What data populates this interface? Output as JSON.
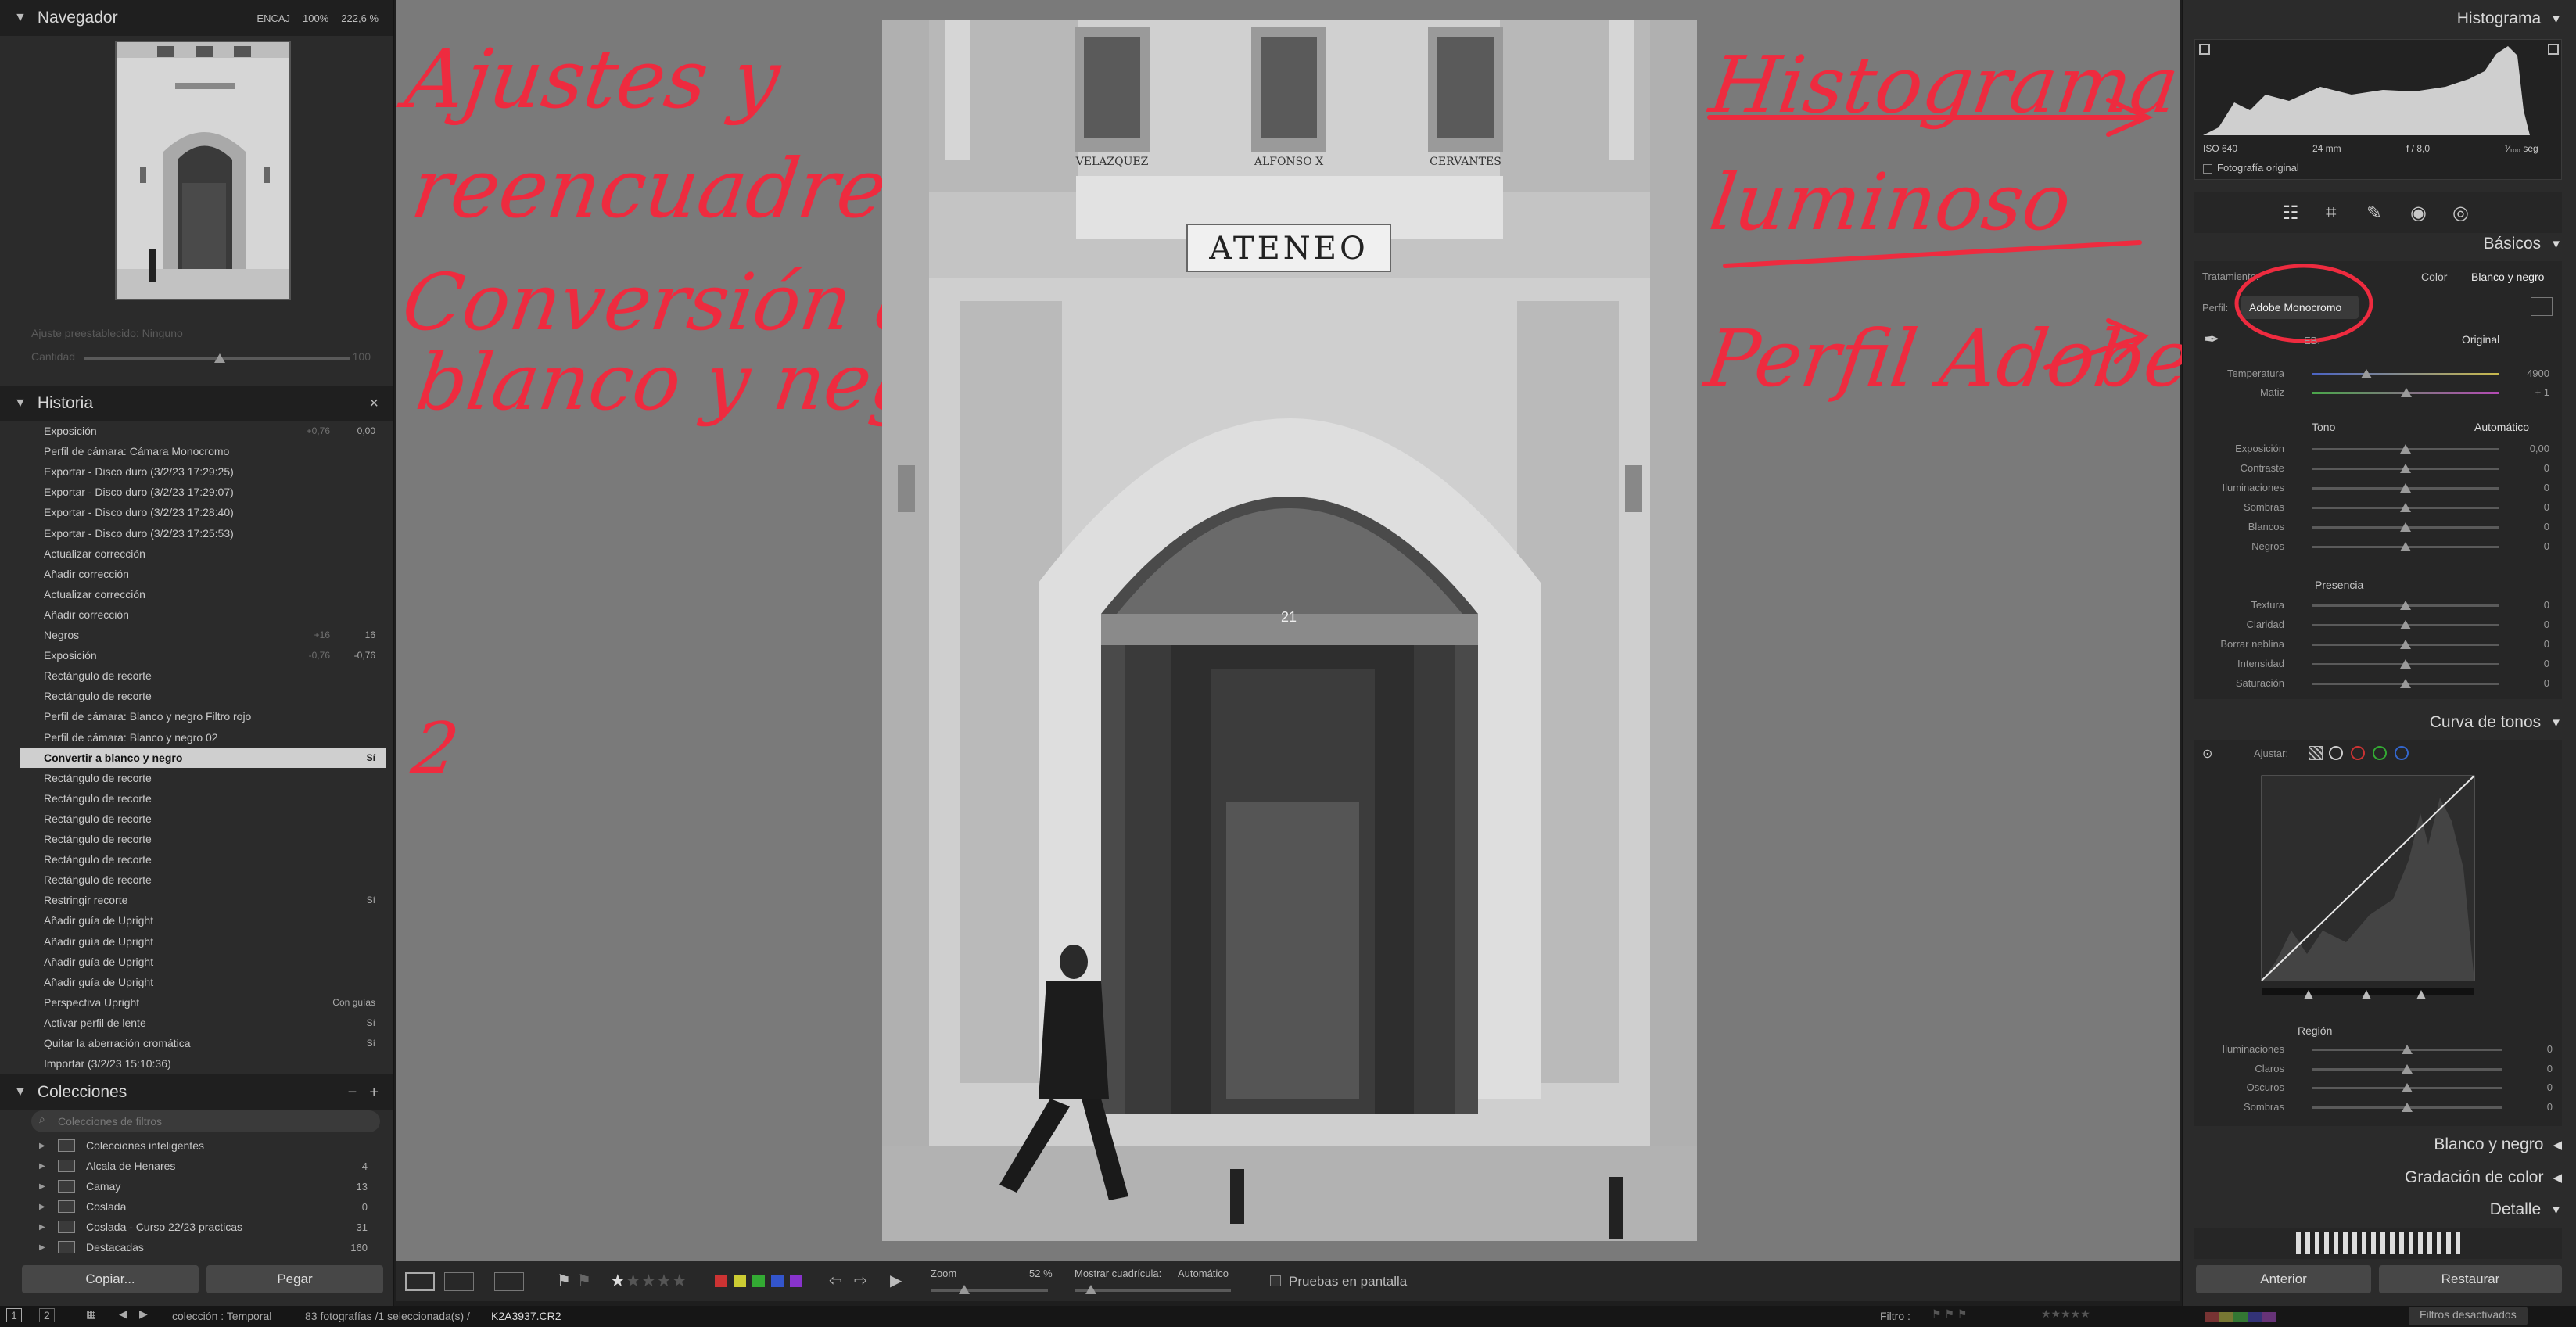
{
  "navigator": {
    "title": "Navegador",
    "fit": "ENCAJ",
    "zoom100": "100%",
    "zoom222": "222,6 %"
  },
  "preset": {
    "label": "Ajuste preestablecido: Ninguno",
    "amount_label": "Cantidad",
    "amount_value": "100"
  },
  "history": {
    "title": "Historia",
    "close": "×",
    "items": [
      {
        "label": "Exposición",
        "v1": "+0,76",
        "v2": "0,00"
      },
      {
        "label": "Perfil de cámara: Cámara Monocromo",
        "v1": "",
        "v2": ""
      },
      {
        "label": "Exportar - Disco duro (3/2/23 17:29:25)",
        "v1": "",
        "v2": ""
      },
      {
        "label": "Exportar - Disco duro (3/2/23 17:29:07)",
        "v1": "",
        "v2": ""
      },
      {
        "label": "Exportar - Disco duro (3/2/23 17:28:40)",
        "v1": "",
        "v2": ""
      },
      {
        "label": "Exportar - Disco duro (3/2/23 17:25:53)",
        "v1": "",
        "v2": ""
      },
      {
        "label": "Actualizar corrección",
        "v1": "",
        "v2": ""
      },
      {
        "label": "Añadir corrección",
        "v1": "",
        "v2": ""
      },
      {
        "label": "Actualizar corrección",
        "v1": "",
        "v2": ""
      },
      {
        "label": "Añadir corrección",
        "v1": "",
        "v2": ""
      },
      {
        "label": "Negros",
        "v1": "+16",
        "v2": "16"
      },
      {
        "label": "Exposición",
        "v1": "-0,76",
        "v2": "-0,76"
      },
      {
        "label": "Rectángulo de recorte",
        "v1": "",
        "v2": ""
      },
      {
        "label": "Rectángulo de recorte",
        "v1": "",
        "v2": ""
      },
      {
        "label": "Perfil de cámara: Blanco y negro Filtro rojo",
        "v1": "",
        "v2": ""
      },
      {
        "label": "Perfil de cámara: Blanco y negro 02",
        "v1": "",
        "v2": ""
      },
      {
        "label": "Convertir a blanco y negro",
        "v1": "",
        "v2": "Sí"
      },
      {
        "label": "Rectángulo de recorte",
        "v1": "",
        "v2": ""
      },
      {
        "label": "Rectángulo de recorte",
        "v1": "",
        "v2": ""
      },
      {
        "label": "Rectángulo de recorte",
        "v1": "",
        "v2": ""
      },
      {
        "label": "Rectángulo de recorte",
        "v1": "",
        "v2": ""
      },
      {
        "label": "Rectángulo de recorte",
        "v1": "",
        "v2": ""
      },
      {
        "label": "Rectángulo de recorte",
        "v1": "",
        "v2": ""
      },
      {
        "label": "Restringir recorte",
        "v1": "",
        "v2": "Sí"
      },
      {
        "label": "Añadir guía de Upright",
        "v1": "",
        "v2": ""
      },
      {
        "label": "Añadir guía de Upright",
        "v1": "",
        "v2": ""
      },
      {
        "label": "Añadir guía de Upright",
        "v1": "",
        "v2": ""
      },
      {
        "label": "Añadir guía de Upright",
        "v1": "",
        "v2": ""
      },
      {
        "label": "Perspectiva Upright",
        "v1": "",
        "v2": "Con guías"
      },
      {
        "label": "Activar perfil de lente",
        "v1": "",
        "v2": "Sí"
      },
      {
        "label": "Quitar la aberración cromática",
        "v1": "",
        "v2": "Sí"
      },
      {
        "label": "Importar (3/2/23 15:10:36)",
        "v1": "",
        "v2": ""
      }
    ]
  },
  "collections": {
    "title": "Colecciones",
    "minus": "−",
    "plus": "+",
    "search_placeholder": "Colecciones de filtros",
    "items": [
      {
        "label": "Colecciones inteligentes",
        "count": ""
      },
      {
        "label": "Alcala de Henares",
        "count": "4"
      },
      {
        "label": "Camay",
        "count": "13"
      },
      {
        "label": "Coslada",
        "count": "0"
      },
      {
        "label": "Coslada - Curso 22/23 practicas",
        "count": "31"
      },
      {
        "label": "Destacadas",
        "count": "160"
      }
    ]
  },
  "left_buttons": {
    "copy": "Copiar...",
    "paste": "Pegar"
  },
  "annotations": {
    "a1_l1": "Ajustes y",
    "a1_l2": "reencuadres.",
    "a1_l3": "Conversión a",
    "a1_l4": "blanco y negro",
    "a2": "2",
    "a3_l1": "Histograma",
    "a3_l2": "luminoso",
    "a4": "Perfil Adobe"
  },
  "photo": {
    "busts": [
      "VELAZQUEZ",
      "ALFONSO X",
      "CERVANTES"
    ],
    "sign": "ATENEO",
    "number": "21"
  },
  "toolbar": {
    "zoom_label": "Zoom",
    "zoom_value": "52 %",
    "grid_label": "Mostrar cuadrícula:",
    "grid_value": "Automático",
    "proof_label": "Pruebas en pantalla"
  },
  "histogram": {
    "title": "Histograma",
    "iso": "ISO 640",
    "focal": "24 mm",
    "aperture": "f / 8,0",
    "shutter": "¹⁄₁₀₀ seg",
    "original_photo": "Fotografía original"
  },
  "basics": {
    "title": "Básicos",
    "treatment_label": "Tratamiento:",
    "treatment_color": "Color",
    "treatment_bw": "Blanco y negro",
    "profile_label": "Perfil:",
    "profile_value": "Adobe Monocromo",
    "wb_label": "EB:",
    "wb_value": "Original",
    "temp_label": "Temperatura",
    "temp_value": "4900",
    "tint_label": "Matiz",
    "tint_value": "+ 1",
    "tone_label": "Tono",
    "tone_auto": "Automático",
    "tone_sliders": [
      {
        "label": "Exposición",
        "value": "0,00",
        "pos": 0.5
      },
      {
        "label": "Contraste",
        "value": "0",
        "pos": 0.5
      },
      {
        "label": "Iluminaciones",
        "value": "0",
        "pos": 0.5
      },
      {
        "label": "Sombras",
        "value": "0",
        "pos": 0.5
      },
      {
        "label": "Blancos",
        "value": "0",
        "pos": 0.5
      },
      {
        "label": "Negros",
        "value": "0",
        "pos": 0.5
      }
    ],
    "presence_label": "Presencia",
    "presence_sliders": [
      {
        "label": "Textura",
        "value": "0",
        "pos": 0.5
      },
      {
        "label": "Claridad",
        "value": "0",
        "pos": 0.5
      },
      {
        "label": "Borrar neblina",
        "value": "0",
        "pos": 0.5
      },
      {
        "label": "Intensidad",
        "value": "0",
        "pos": 0.5
      },
      {
        "label": "Saturación",
        "value": "0",
        "pos": 0.5
      }
    ]
  },
  "tone_curve": {
    "title": "Curva de tonos",
    "adjust_label": "Ajustar:",
    "region_label": "Región",
    "region_sliders": [
      {
        "label": "Iluminaciones",
        "value": "0",
        "pos": 0.5
      },
      {
        "label": "Claros",
        "value": "0",
        "pos": 0.5
      },
      {
        "label": "Oscuros",
        "value": "0",
        "pos": 0.5
      },
      {
        "label": "Sombras",
        "value": "0",
        "pos": 0.5
      }
    ]
  },
  "sections": {
    "bw": "Blanco y negro",
    "grading": "Gradación de color",
    "detail": "Detalle"
  },
  "right_buttons": {
    "previous": "Anterior",
    "reset": "Restaurar"
  },
  "bottom_bar": {
    "page1": "1",
    "page2": "2",
    "source": "colección : Temporal",
    "count": "83 fotografías /1 seleccionada(s) /",
    "filename": "K2A3937.CR2",
    "filter_label": "Filtro :",
    "filters_off": "Filtros desactivados"
  },
  "colors": {
    "annotation": "#ee2b3f",
    "panel_bg": "#2b2b2b",
    "canvas_bg": "#7a7a7a"
  }
}
